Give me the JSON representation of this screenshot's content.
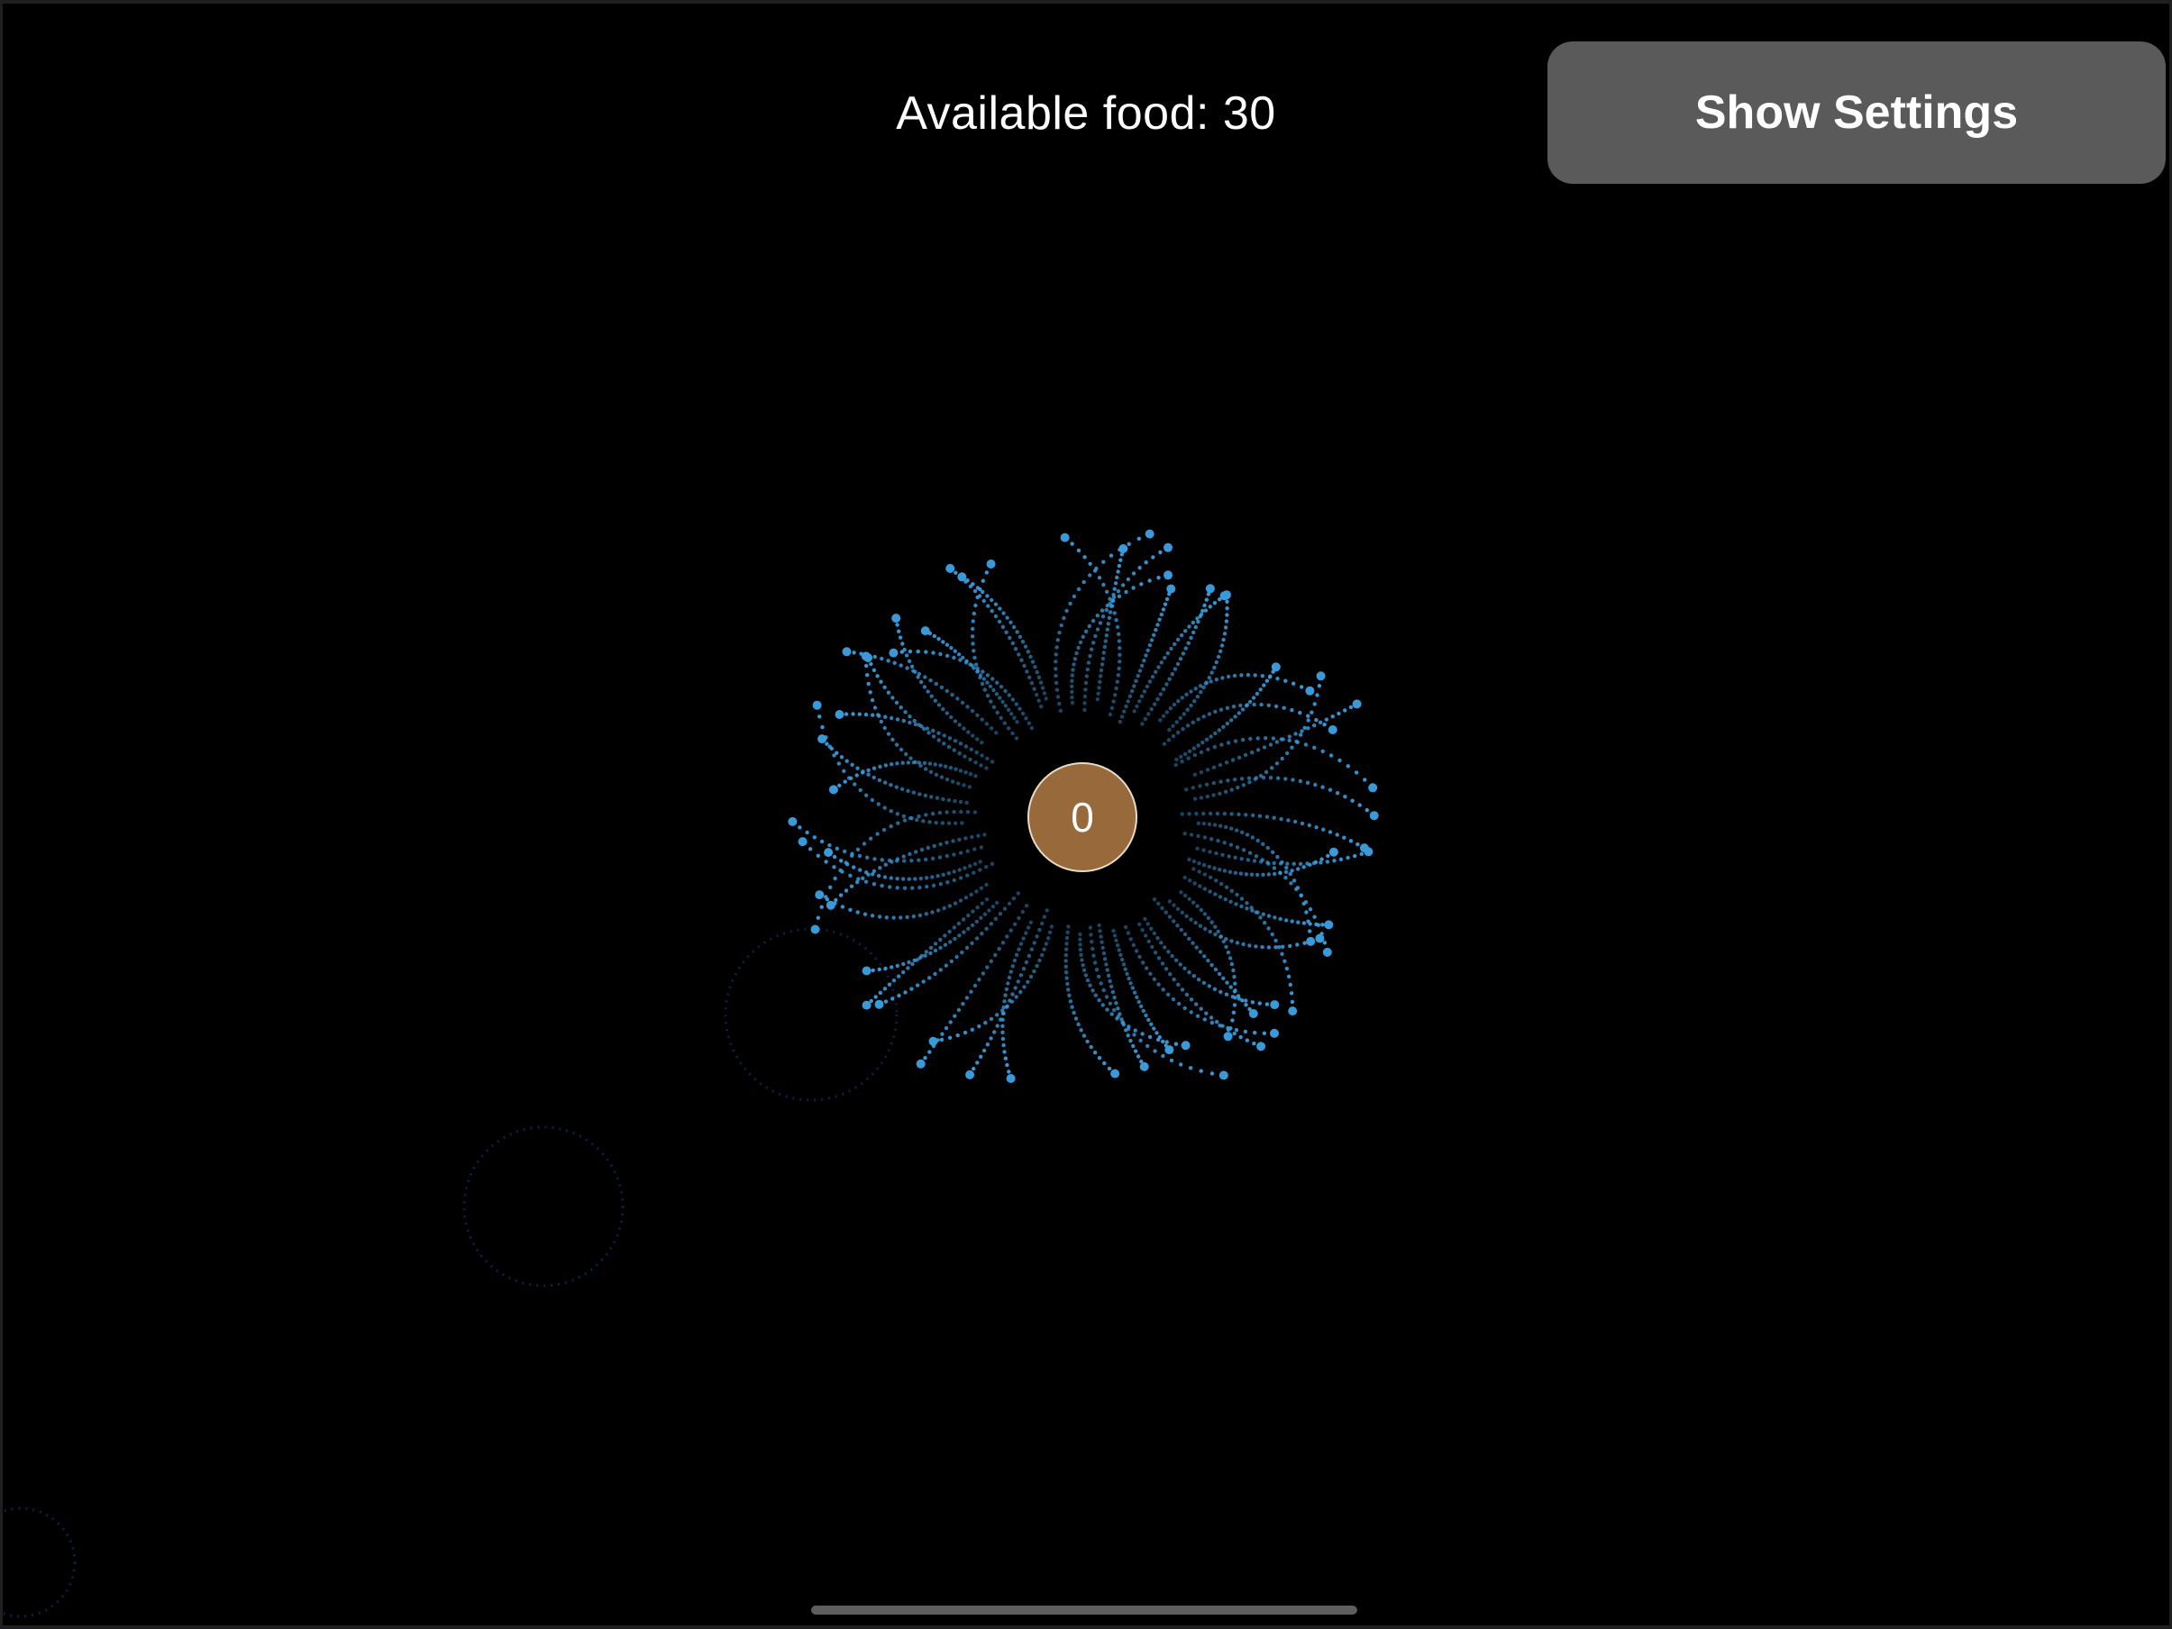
{
  "hud": {
    "food_label": "Available food: 30",
    "settings_button_label": "Show Settings"
  },
  "nest": {
    "count_label": "0",
    "fill_color": "#98693a",
    "border_color": "#e8dcc8"
  },
  "colors": {
    "background": "#000000",
    "ant_trail": "#3a9ad9",
    "faded_pheromone": "#0c2a5a",
    "button_background": "#5a5a5a"
  },
  "icons": {
    "home_indicator": "home-bar"
  }
}
